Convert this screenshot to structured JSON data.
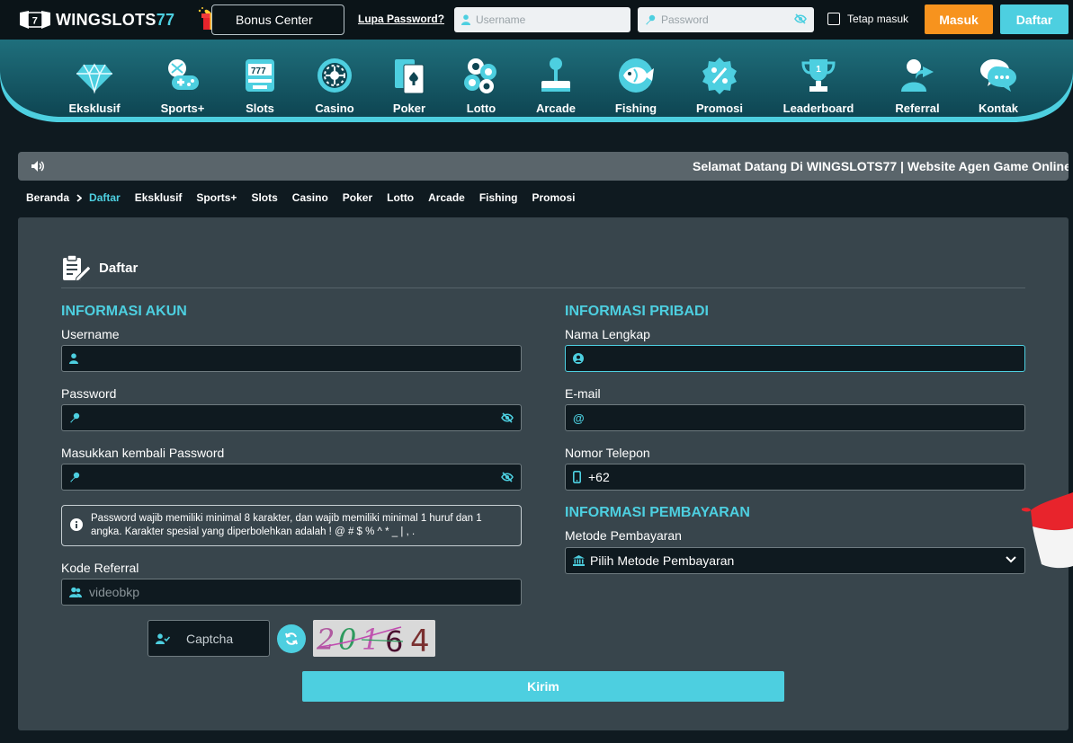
{
  "header": {
    "logo_text": "WINGSLOTS",
    "logo_number": "77",
    "logo_badge": "7",
    "bonus_center": "Bonus Center",
    "forgot_password": "Lupa Password?",
    "username_placeholder": "Username",
    "password_placeholder": "Password",
    "remember_me": "Tetap masuk",
    "login_button": "Masuk",
    "register_button": "Daftar"
  },
  "nav": {
    "items": [
      {
        "label": "Eksklusif",
        "icon": "diamond-icon"
      },
      {
        "label": "Sports+",
        "icon": "gamepad-icon"
      },
      {
        "label": "Slots",
        "icon": "slot-machine-icon"
      },
      {
        "label": "Casino",
        "icon": "roulette-icon"
      },
      {
        "label": "Poker",
        "icon": "cards-icon"
      },
      {
        "label": "Lotto",
        "icon": "lotto-balls-icon"
      },
      {
        "label": "Arcade",
        "icon": "joystick-icon"
      },
      {
        "label": "Fishing",
        "icon": "fish-icon"
      },
      {
        "label": "Promosi",
        "icon": "percent-badge-icon"
      },
      {
        "label": "Leaderboard",
        "icon": "trophy-icon"
      },
      {
        "label": "Referral",
        "icon": "user-share-icon"
      },
      {
        "label": "Kontak",
        "icon": "chat-bubble-icon"
      }
    ]
  },
  "marquee": {
    "text": "Selamat Datang Di WINGSLOTS77 | Website Agen Game Online"
  },
  "breadcrumb": {
    "home": "Beranda",
    "current": "Daftar",
    "links": [
      "Eksklusif",
      "Sports+",
      "Slots",
      "Casino",
      "Poker",
      "Lotto",
      "Arcade",
      "Fishing",
      "Promosi"
    ]
  },
  "form": {
    "title": "Daftar",
    "account_section": "INFORMASI AKUN",
    "personal_section": "INFORMASI PRIBADI",
    "payment_section": "INFORMASI PEMBAYARAN",
    "username_label": "Username",
    "password_label": "Password",
    "confirm_password_label": "Masukkan kembali Password",
    "password_notice": "Password wajib memiliki minimal 8 karakter, dan wajib memiliki minimal 1 huruf dan 1 angka. Karakter spesial yang diperbolehkan adalah ! @ # $ % ^ * _ | , .",
    "referral_label": "Kode Referral",
    "referral_value": "videobkp",
    "fullname_label": "Nama Lengkap",
    "email_label": "E-mail",
    "phone_label": "Nomor Telepon",
    "phone_prefix": "+62",
    "payment_method_label": "Metode Pembayaran",
    "payment_method_value": "Pilih Metode Pembayaran",
    "captcha_placeholder": "Captcha",
    "captcha_code": [
      "2",
      "0",
      "1",
      "6",
      "4"
    ],
    "submit_label": "Kirim"
  },
  "colors": {
    "accent": "#4dcfe0",
    "login": "#f7931e",
    "panel": "#38454c",
    "field": "#0f1a20"
  }
}
